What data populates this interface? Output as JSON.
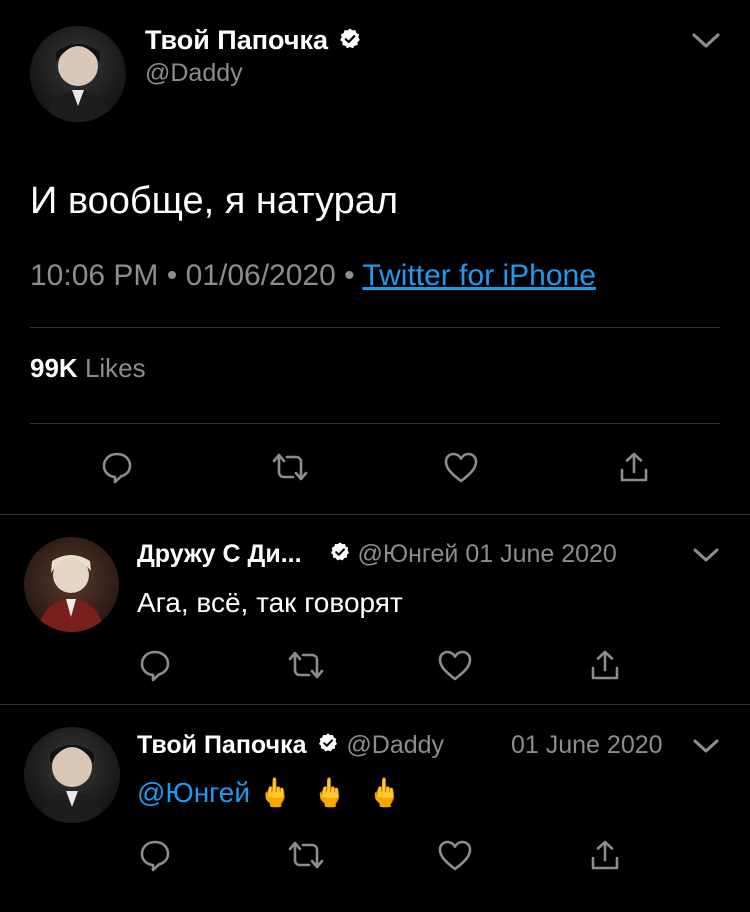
{
  "main_tweet": {
    "author_name": "Твой Папочка",
    "handle": "@Daddy",
    "text": "И вообще, я натурал",
    "time": "10:06 PM",
    "date": "01/06/2020",
    "separator": "•",
    "source": "Twitter for iPhone",
    "likes_count": "99K",
    "likes_label": "Likes"
  },
  "replies": [
    {
      "author_name": "Дружу С Ди...",
      "handle": "@Юнгей",
      "date": "01 June 2020",
      "text": "Ага, всё, так говорят"
    },
    {
      "author_name": "Твой Папочка",
      "handle": "@Daddy",
      "date": "01 June 2020",
      "mention": "@Юнгей",
      "emojis": "🖕 🖕 🖕"
    }
  ],
  "colors": {
    "background": "#000000",
    "muted": "#8a8d91",
    "link": "#1d9bf0",
    "divider": "#2f3336"
  },
  "icons": [
    "verified-badge-icon",
    "chevron-down-icon",
    "reply-icon",
    "retweet-icon",
    "like-icon",
    "share-icon"
  ]
}
